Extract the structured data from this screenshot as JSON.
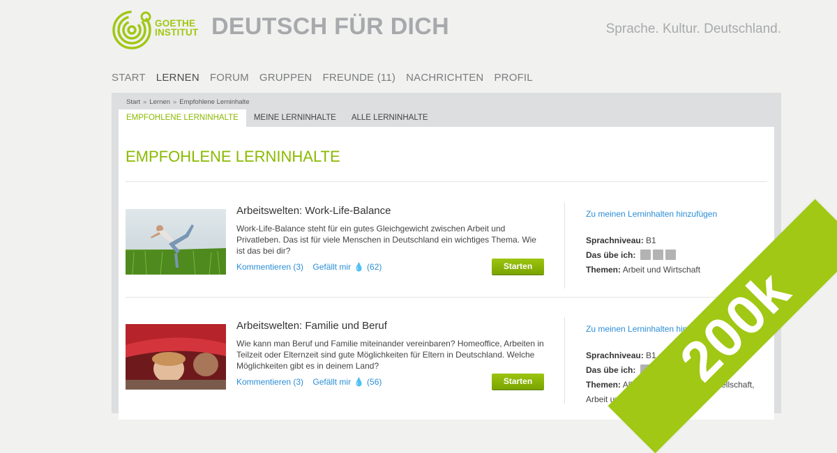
{
  "header": {
    "logo_line1": "GOETHE",
    "logo_line2": "INSTITUT",
    "site_title": "DEUTSCH FÜR DICH",
    "tagline": "Sprache. Kultur. Deutschland."
  },
  "nav": {
    "items": [
      "START",
      "LERNEN",
      "FORUM",
      "GRUPPEN",
      "FREUNDE (11)",
      "NACHRICHTEN",
      "PROFIL"
    ],
    "active_index": 1
  },
  "breadcrumb": [
    "Start",
    "Lernen",
    "Empfohlene Lerninhalte"
  ],
  "breadcrumb_sep": "»",
  "subtabs": [
    "EMPFOHLENE LERNINHALTE",
    "MEINE LERNINHALTE",
    "ALLE LERNINHALTE"
  ],
  "page_heading": "EMPFOHLENE LERNINHALTE",
  "items": [
    {
      "title": "Arbeitswelten: Work-Life-Balance",
      "description": "Work-Life-Balance steht für ein gutes Gleichgewicht zwischen Arbeit und Privatleben. Das ist für viele Menschen in Deutschland ein wichtiges Thema. Wie ist das bei dir?",
      "comments": "Kommentieren (3)",
      "like": "Gefällt mir",
      "like_count": "(62)",
      "start": "Starten",
      "add": "Zu meinen Lerninhalten hinzufügen",
      "level_label": "Sprachniveau:",
      "level": "B1",
      "practice_label": "Das übe ich:",
      "topics_label": "Themen:",
      "topics": "Arbeit und Wirtschaft"
    },
    {
      "title": "Arbeitswelten: Familie und Beruf",
      "description": "Wie kann man Beruf und Familie miteinander vereinbaren? Homeoffice, Arbeiten in Teilzeit oder Elternzeit sind gute Möglichkeiten für Eltern in Deutschland. Welche Möglichkeiten gibt es in deinem Land?",
      "comments": "Kommentieren (3)",
      "like": "Gefällt mir",
      "like_count": "(56)",
      "start": "Starten",
      "add": "Zu meinen Lerninhalten hinzufügen",
      "level_label": "Sprachniveau:",
      "level": "B1",
      "practice_label": "Das übe ich:",
      "topics_label": "Themen:",
      "topics": "Alltag in Deutschland, Gesellschaft, Arbeit und ..."
    }
  ],
  "badge": "200k"
}
